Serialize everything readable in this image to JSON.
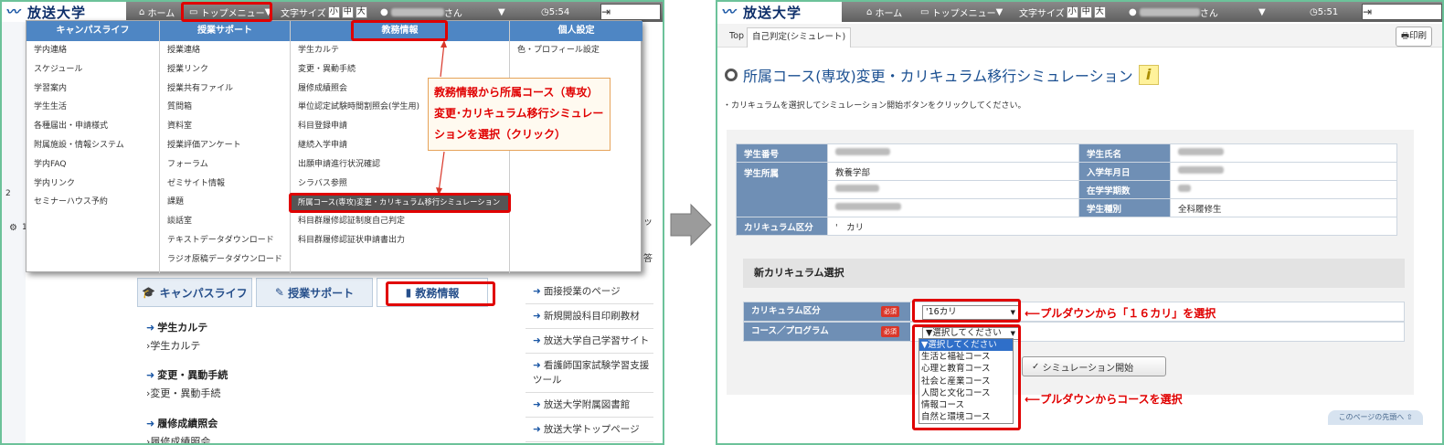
{
  "left": {
    "logo": "放送大学",
    "topbar": {
      "home": "ホーム",
      "topmenu": "トップメニュー",
      "fontsize": "文字サイズ",
      "sizes": [
        "小",
        "中",
        "大"
      ],
      "user_suffix": "さん",
      "time": "5:54"
    },
    "menu": {
      "columns": [
        {
          "header": "キャンパスライフ",
          "items": [
            "学内連絡",
            "スケジュール",
            "学習案内",
            "学生生活",
            "各種届出・申請様式",
            "附属施設・情報システム",
            "学内FAQ",
            "学内リンク",
            "セミナーハウス予約"
          ]
        },
        {
          "header": "授業サポート",
          "items": [
            "授業連絡",
            "授業リンク",
            "授業共有ファイル",
            "質問箱",
            "資料室",
            "授業評価アンケート",
            "フォーラム",
            "ゼミサイト情報",
            "課題",
            "談話室",
            "テキストデータダウンロード",
            "ラジオ原稿データダウンロード"
          ]
        },
        {
          "header": "教務情報",
          "items": [
            "学生カルテ",
            "変更・異動手続",
            "履修成績照会",
            "単位認定試験時間割照会(学生用)",
            "科目登録申請",
            "継続入学申請",
            "出願申請進行状況確認",
            "シラバス参照",
            "所属コース(専攻)変更・カリキュラム移行シミュレーション",
            "科目群履修認証制度自己判定",
            "科目群履修認証状申請書出力"
          ]
        },
        {
          "header": "個人設定",
          "items": [
            "色・プロフィール設定"
          ]
        }
      ]
    },
    "callout": "教務情報から所属コース（専攻）変更･カリキュラム移行シミュレーションを選択（クリック）",
    "tabs": [
      "キャンパスライフ",
      "授業サポート",
      "教務情報"
    ],
    "sections": [
      {
        "title": "学生カルテ",
        "link": "学生カルテ"
      },
      {
        "title": "変更・異動手続",
        "link": "変更・異動手続"
      },
      {
        "title": "履修成績照会",
        "link": "履修成績照会"
      }
    ],
    "right_links": [
      "面接授業のページ",
      "新規開設科目印刷教材",
      "放送大学自己学習サイト",
      "看護師国家試験学習支援ツール",
      "放送大学附属図書館",
      "放送大学トップページ"
    ],
    "edge_fragments": [
      "2",
      "1",
      "ッ",
      "答",
      "印刷"
    ]
  },
  "right": {
    "logo": "放送大学",
    "topbar": {
      "home": "ホーム",
      "topmenu": "トップメニュー",
      "fontsize": "文字サイズ",
      "sizes": [
        "小",
        "中",
        "大"
      ],
      "user_suffix": "さん",
      "time": "5:51"
    },
    "breadcrumb": {
      "top": "Top",
      "current": "自己判定(シミュレート)",
      "print": "印刷"
    },
    "title": "所属コース(専攻)変更・カリキュラム移行シミュレーション",
    "info_badge": "i",
    "note": "・カリキュラムを選択してシミュレーション開始ボタンをクリックしてください。",
    "student": {
      "no_label": "学生番号",
      "name_label": "学生氏名",
      "affil_label": "学生所属",
      "affil_value": "教養学部",
      "enroll_label": "入学年月日",
      "term_label": "在学学期数",
      "type_label": "学生種別",
      "type_value": "全科履修生",
      "curr_label": "カリキュラム区分",
      "curr_value": "'　カリ"
    },
    "new_section": "新カリキュラム選択",
    "form": {
      "curr_label": "カリキュラム区分",
      "required": "必須",
      "curr_value": "'16カリ",
      "course_label": "コース／プログラム",
      "course_value": "▼選択してください",
      "options": [
        "▼選択してください",
        "生活と福祉コース",
        "心理と教育コース",
        "社会と産業コース",
        "人間と文化コース",
        "情報コース",
        "自然と環境コース"
      ],
      "start_button": "シミュレーション開始"
    },
    "annotations": [
      "プルダウンから「１６カリ」を選択",
      "プルダウンからコースを選択"
    ],
    "page_top": "このページの先頭へ"
  }
}
